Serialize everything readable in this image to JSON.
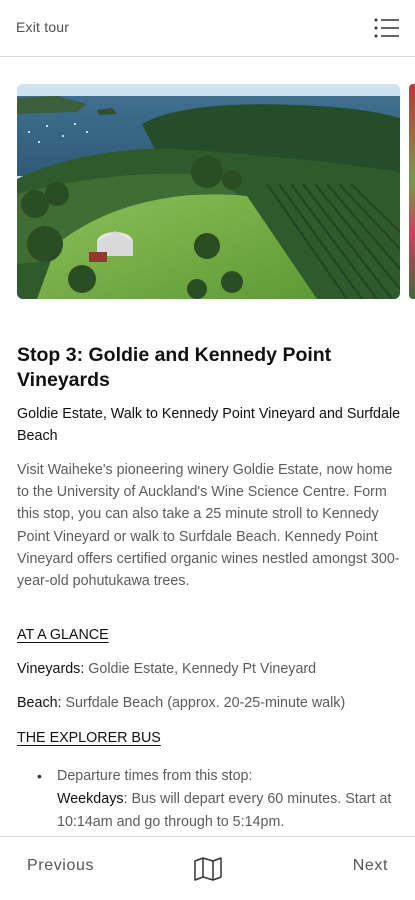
{
  "header": {
    "exit_label": "Exit tour",
    "menu_icon": "menu-icon"
  },
  "photo": {
    "icon": "vineyard-aerial-photo"
  },
  "stop": {
    "title": "Stop 3: Goldie and Kennedy Point Vineyards",
    "subtitle": "Goldie Estate, Walk to Kennedy Point Vineyard and Surfdale Beach",
    "description": "Visit Waiheke's pioneering winery Goldie Estate, now home to the University of Auckland's Wine Science Centre. Form this stop, you can also take a 25 minute stroll to Kennedy Point Vineyard or walk to Surfdale Beach. Kennedy Point Vineyard offers certified organic wines nestled amongst 300-year-old pohutukawa trees."
  },
  "glance": {
    "heading": "AT A GLANCE",
    "vineyards_label": "Vineyards:",
    "vineyards_value": " Goldie Estate, Kennedy Pt Vineyard",
    "beach_label": "Beach:",
    "beach_value": " Surfdale Beach (approx. 20-25-minute walk)"
  },
  "bus": {
    "heading": "THE EXPLORER BUS",
    "bullet_intro": "Departure times from this stop:",
    "weekdays_label": "Weekdays",
    "weekdays_text": ": Bus will depart every 60 minutes. Start at 10:14am and go through to 5:14pm."
  },
  "footer": {
    "previous_label": "Previous",
    "next_label": "Next",
    "map_icon": "map-icon"
  },
  "colors": {
    "text_dark": "#111111",
    "text_muted": "#5c5c5c",
    "divider": "#dcdcdc"
  }
}
